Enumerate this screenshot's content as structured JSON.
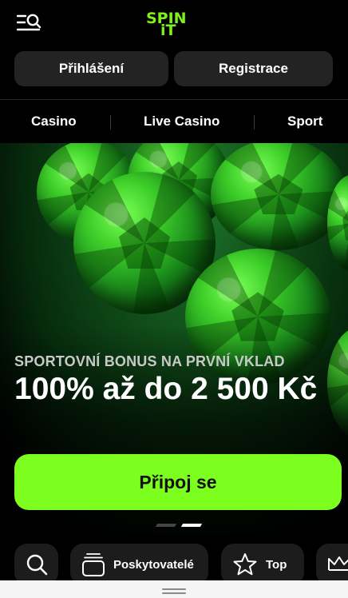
{
  "header": {
    "logo_line1": "SPIN",
    "logo_line2": "iT",
    "brand_color": "#7cf21c",
    "menu_icon": "menu-search-icon"
  },
  "auth": {
    "login_label": "Přihlášení",
    "register_label": "Registrace"
  },
  "nav": {
    "items": [
      {
        "label": "Casino"
      },
      {
        "label": "Live Casino"
      },
      {
        "label": "Sport"
      }
    ]
  },
  "hero": {
    "kicker": "SPORTOVNÍ BONUS NA PRVNÍ VKLAD",
    "title": "100% až do 2 500 Kč",
    "cta_label": "Připoj se",
    "cta_color": "#7cff1e",
    "slides_total": 2,
    "active_slide": 2
  },
  "chips": [
    {
      "label": "",
      "icon": "search-icon"
    },
    {
      "label": "Poskytovatelé",
      "icon": "providers-icon"
    },
    {
      "label": "Top",
      "icon": "star-icon"
    },
    {
      "label": "",
      "icon": "crown-icon"
    }
  ]
}
